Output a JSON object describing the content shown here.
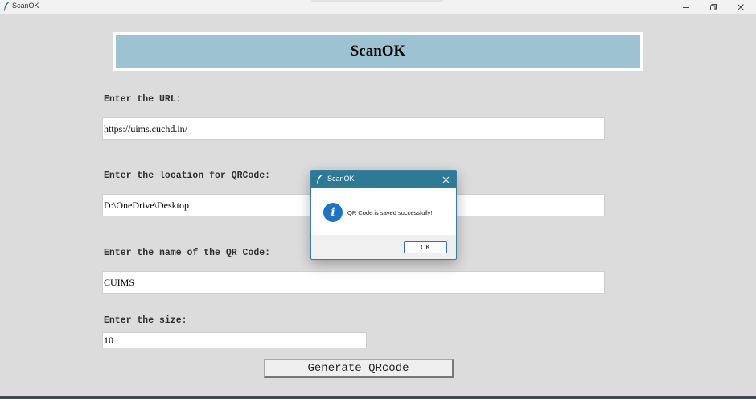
{
  "window": {
    "title": "ScanOK",
    "controls": [
      "minimize",
      "restore",
      "close"
    ]
  },
  "app": {
    "banner_title": "ScanOK"
  },
  "form": {
    "url_label": "Enter the URL:",
    "url_value": "https://uims.cuchd.in/",
    "location_label": "Enter the location for QRCode:",
    "location_value": "D:\\OneDrive\\Desktop",
    "name_label": "Enter the name of the QR Code:",
    "name_value": "CUIMS",
    "size_label": "Enter the size:",
    "size_value": "10",
    "generate_button": "Generate QRcode"
  },
  "dialog": {
    "title": "ScanOK",
    "message": "QR Code is saved successfully!",
    "ok_label": "OK",
    "icon": "info-icon"
  },
  "colors": {
    "banner": "#9dc3d2",
    "background": "#dcdcdc",
    "dialog_title": "#2b7a96",
    "info_icon": "#1f73c4"
  }
}
